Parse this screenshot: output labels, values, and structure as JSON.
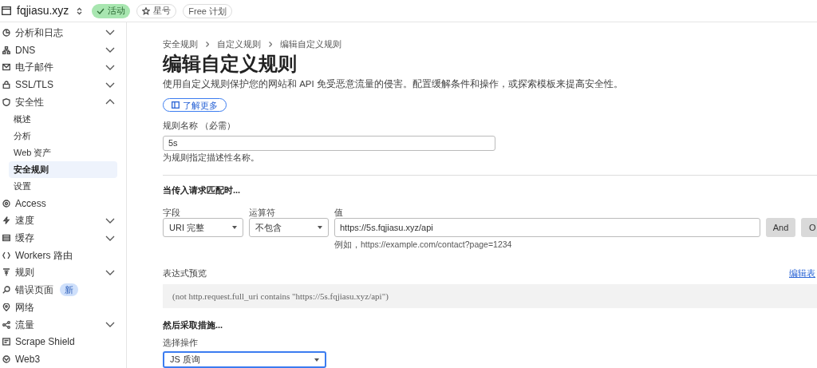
{
  "header": {
    "site": "fqjiasu.xyz",
    "status_badge": "活动",
    "star_button": "星号",
    "plan_badge": "Free 计划"
  },
  "sidebar": {
    "items": [
      {
        "label": "分析和日志",
        "expanded": false
      },
      {
        "label": "DNS",
        "expanded": false
      },
      {
        "label": "电子邮件",
        "expanded": false
      },
      {
        "label": "SSL/TLS",
        "expanded": false
      },
      {
        "label": "安全性",
        "expanded": true,
        "children": [
          {
            "label": "概述",
            "selected": false
          },
          {
            "label": "分析",
            "selected": false
          },
          {
            "label": "Web 资产",
            "selected": false
          },
          {
            "label": "安全规则",
            "selected": true
          },
          {
            "label": "设置",
            "selected": false
          }
        ]
      },
      {
        "label": "Access"
      },
      {
        "label": "速度",
        "expanded": false
      },
      {
        "label": "缓存",
        "expanded": false
      },
      {
        "label": "Workers 路由"
      },
      {
        "label": "规则",
        "expanded": false
      },
      {
        "label": "错误页面",
        "badge": "新"
      },
      {
        "label": "网络"
      },
      {
        "label": "流量",
        "expanded": false
      },
      {
        "label": "Scrape Shield"
      },
      {
        "label": "Web3"
      }
    ]
  },
  "breadcrumb": [
    "安全规则",
    "自定义规则",
    "编辑自定义规则"
  ],
  "title": "编辑自定义规则",
  "description": "使用自定义规则保护您的网站和 API 免受恶意流量的侵害。配置缓解条件和操作，或探索模板来提高安全性。",
  "learn_more": "了解更多",
  "rule_name": {
    "label": "规则名称 （必需）",
    "value": "5s",
    "help": "为规则指定描述性名称。"
  },
  "match_section": {
    "heading": "当传入请求匹配时...",
    "field_label": "字段",
    "field_value": "URI 完整",
    "operator_label": "运算符",
    "operator_value": "不包含",
    "value_label": "值",
    "value": "https://5s.fqjiasu.xyz/api",
    "value_hint": "例如，https://example.com/contact?page=1234",
    "buttons": [
      "And",
      "O"
    ]
  },
  "expression": {
    "label": "表达式预览",
    "edit_link": "编辑表",
    "preview": "(not http.request.full_uri contains \"https://5s.fqjiasu.xyz/api\")"
  },
  "action_section": {
    "heading": "然后采取措施...",
    "label": "选择操作",
    "value": "JS 质询"
  }
}
